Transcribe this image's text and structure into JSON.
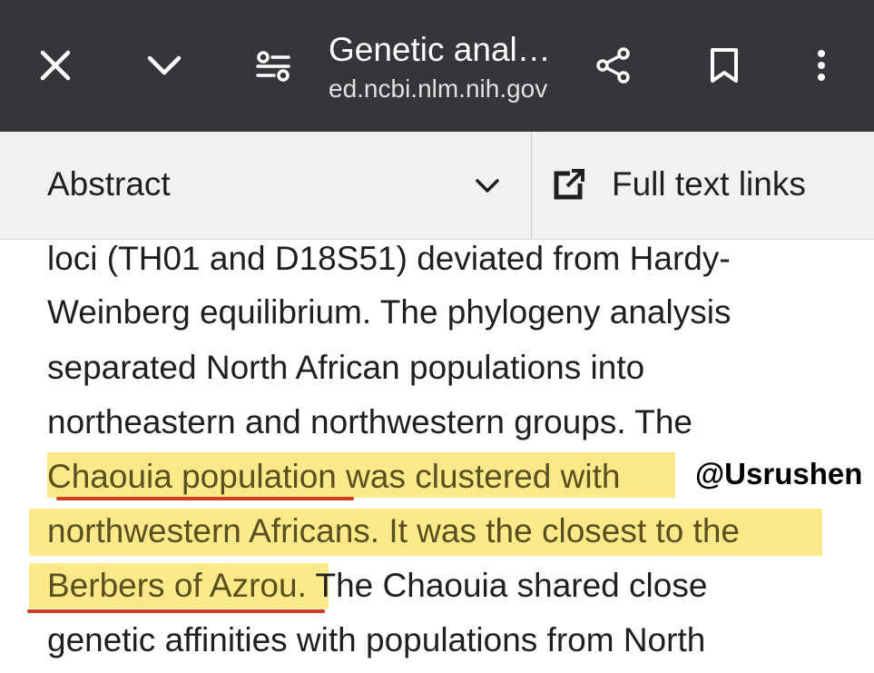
{
  "toolbar": {
    "close_icon": "close-icon",
    "collapse_icon": "chevron-down-icon",
    "page_settings_icon": "page-settings-icon",
    "title": "Genetic anal…",
    "host": "ed.ncbi.nlm.nih.gov",
    "share_icon": "share-icon",
    "bookmark_icon": "bookmark-icon",
    "menu_icon": "more-vert-icon"
  },
  "subbar": {
    "section_label": "Abstract",
    "full_text_label": "Full text links"
  },
  "article": {
    "lines": [
      "loci (TH01 and D18S51) deviated from Hardy-",
      "Weinberg equilibrium. The phylogeny analysis",
      "separated North African populations into",
      "northeastern and northwestern groups. The",
      "Chaouia population was clustered with",
      "northwestern Africans. It was the closest to the",
      "Berbers of Azrou.",
      " The Chaouia shared close",
      "genetic affinities with populations from North"
    ]
  },
  "watermark": "@Usrushen",
  "colors": {
    "toolbar_bg": "#35363a",
    "subbar_bg": "#f1f1f1",
    "highlight": "#fbe98a",
    "underline": "#c8401e"
  }
}
